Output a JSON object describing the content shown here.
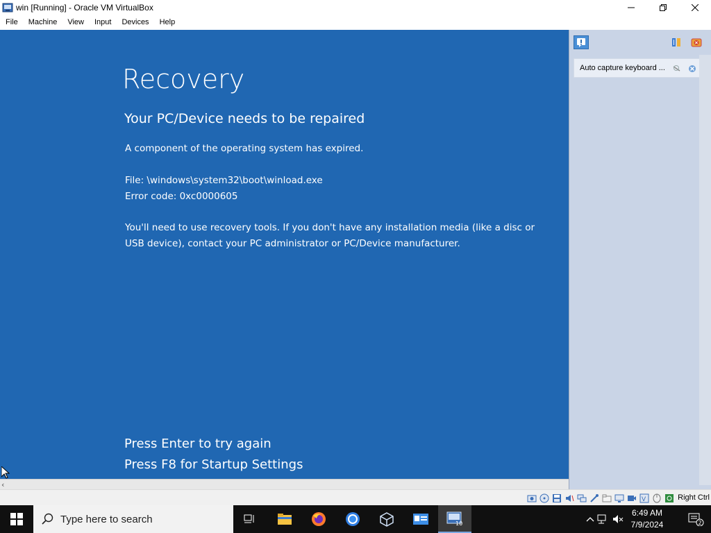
{
  "window": {
    "title": "win [Running] - Oracle VM VirtualBox"
  },
  "menu": {
    "items": [
      "File",
      "Machine",
      "View",
      "Input",
      "Devices",
      "Help"
    ]
  },
  "guest": {
    "title": "Recovery",
    "subtitle": "Your PC/Device needs to be repaired",
    "message": "A component of the operating system has expired.",
    "file_line": "File: \\windows\\system32\\boot\\winload.exe",
    "error_line": "Error code: 0xc0000605",
    "advice": "You'll need to use recovery tools. If you don't have any installation media (like a disc or USB device), contact your PC administrator or PC/Device manufacturer.",
    "action_enter": "Press Enter to try again",
    "action_f8": "Press F8 for Startup Settings",
    "background_color": "#2067b2"
  },
  "side_panel": {
    "notice_text": "Auto capture keyboard ..."
  },
  "statusbar": {
    "host_key": "Right Ctrl"
  },
  "taskbar": {
    "search_placeholder": "Type here to search",
    "time": "6:49 AM",
    "date": "7/9/2024",
    "notification_count": "2"
  }
}
